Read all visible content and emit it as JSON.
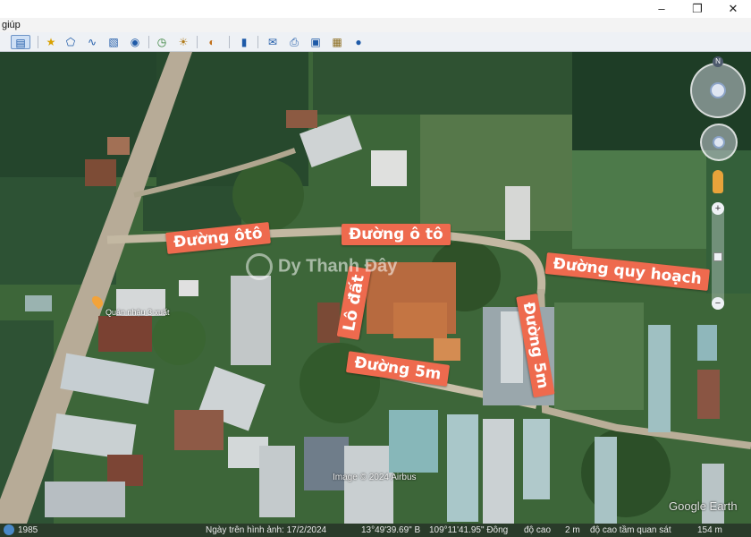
{
  "menu": {
    "label": "giúp"
  },
  "window": {
    "minimize": "–",
    "maximize": "❐",
    "close": "✕"
  },
  "toolbar": {
    "icons": [
      "sidebar-toggle-icon",
      "placemark-icon",
      "polygon-icon",
      "path-icon",
      "image-overlay-icon",
      "tour-icon",
      "historical-imagery-icon",
      "sunlight-icon",
      "planets-icon",
      "ruler-icon",
      "email-icon",
      "print-icon",
      "save-image-icon",
      "maps-icon",
      "earth-gallery-icon"
    ]
  },
  "map": {
    "labels": {
      "road_car_1": "Đường ôtô",
      "road_car_2": "Đường ô tô",
      "road_planned": "Đường quy hoạch",
      "lot": "Lô đất",
      "road_5m_h": "Đường 5m",
      "road_5m_v": "Đường 5m"
    },
    "watermark": "Dy Thanh Đây",
    "place_name": "Quán nhậu 3 xuất",
    "copyright": "Image © 2024 Airbus",
    "brand": "Google Earth"
  },
  "status": {
    "year": "1985",
    "date": "Ngày trên hình ảnh: 17/2/2024",
    "lat": "13°49'39.69\" B",
    "lon": "109°11'41.95\" Đông",
    "elev_label": "độ cao",
    "elev_value": "2 m",
    "eye_label": "độ cao tầm quan sát",
    "eye_value": "154 m"
  },
  "colors": {
    "label_bg": "#ee6a4e",
    "status_bg": "#2a3b2a"
  }
}
